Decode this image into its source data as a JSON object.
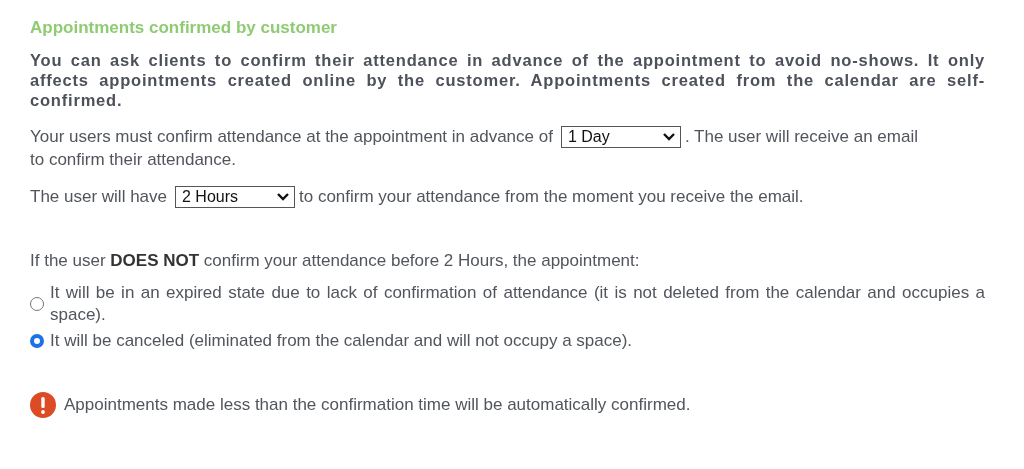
{
  "title": "Appointments confirmed by customer",
  "intro": "You can ask clients to confirm their attendance in advance of the appointment to avoid no-shows. It only affects appointments created online by the customer. Appointments created from the calendar are self-confirmed.",
  "advance": {
    "before": "Your users must confirm attendance at the appointment in advance of",
    "value": "1 Day",
    "after": ". The user will receive an email",
    "after_2": "to confirm their attendance."
  },
  "window": {
    "before": "The user will have",
    "value": "2 Hours",
    "after": "to confirm your attendance from the moment you receive the email."
  },
  "question": "If the user **DOES NOT** confirm your attendance before 2 Hours, the appointment:",
  "options": [
    {
      "label": "It will be in an expired state due to lack of confirmation of attendance (it is not deleted from the calendar and occupies a space).",
      "selected": false
    },
    {
      "label": "It will be canceled (eliminated from the calendar and will not occupy a space).",
      "selected": true
    }
  ],
  "notice": "Appointments made less than the confirmation time will be automatically confirmed."
}
